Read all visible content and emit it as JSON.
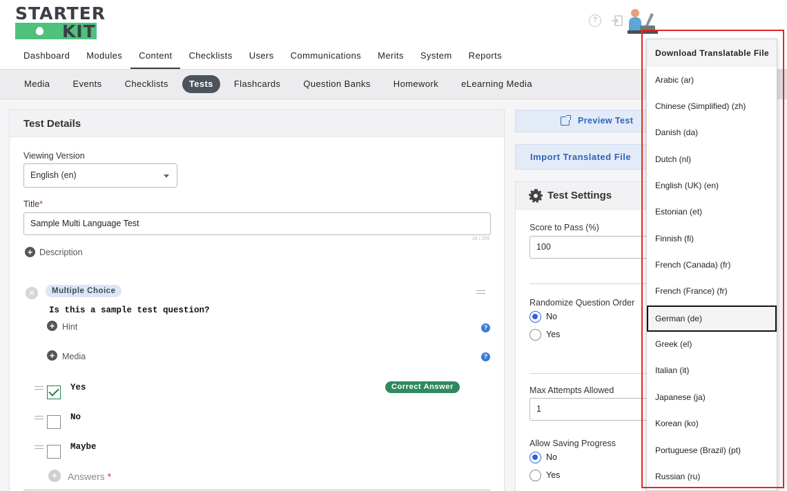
{
  "logo": {
    "line1": "STARTER",
    "line2": "KIT"
  },
  "header": {
    "help_icon": "?"
  },
  "main_nav": [
    "Dashboard",
    "Modules",
    "Content",
    "Checklists",
    "Users",
    "Communications",
    "Merits",
    "System",
    "Reports"
  ],
  "main_nav_active": "Content",
  "sub_nav": [
    "Media",
    "Events",
    "Checklists",
    "Tests",
    "Flashcards",
    "Question Banks",
    "Homework",
    "eLearning Media"
  ],
  "sub_nav_active": "Tests",
  "details": {
    "heading": "Test Details",
    "viewing_version_label": "Viewing Version",
    "viewing_version_value": "English (en)",
    "title_label": "Title",
    "required_mark": "*",
    "title_value": "Sample Multi Language Test",
    "title_counter": "26 / 255",
    "description_label": "Description",
    "question_type": "Multiple Choice",
    "question_text": "Is this a sample test question?",
    "hint_label": "Hint",
    "media_label": "Media",
    "info_glyph": "?",
    "remove_glyph": "✕",
    "plus_glyph": "+",
    "options": [
      {
        "text": "Yes",
        "checked": true
      },
      {
        "text": "No",
        "checked": false
      },
      {
        "text": "Maybe",
        "checked": false
      }
    ],
    "correct_badge": "Correct Answer",
    "answers_label": "Answers"
  },
  "actions": {
    "preview_label": "Preview Test",
    "import_label": "Import Translated File"
  },
  "settings": {
    "heading": "Test Settings",
    "score_label": "Score to Pass (%)",
    "score_value": "100",
    "randomize_label": "Randomize Question Order",
    "randomize_selected": "No",
    "no_label": "No",
    "yes_label": "Yes",
    "max_attempts_label": "Max Attempts Allowed",
    "max_attempts_value": "1",
    "saving_label": "Allow Saving Progress",
    "saving_selected": "No"
  },
  "menu": {
    "items": [
      "Download Translatable File",
      "Arabic (ar)",
      "Chinese (Simplified) (zh)",
      "Danish (da)",
      "Dutch (nl)",
      "English (UK) (en)",
      "Estonian (et)",
      "Finnish (fi)",
      "French (Canada) (fr)",
      "French (France) (fr)",
      "German (de)",
      "Greek (el)",
      "Italian (it)",
      "Japanese (ja)",
      "Korean (ko)",
      "Portuguese (Brazil) (pt)",
      "Russian (ru)"
    ],
    "highlighted": "German (de)"
  },
  "colors": {
    "brand_green": "#4fc17c",
    "accent_blue": "#2f64b8",
    "correct_green": "#2f8a5e",
    "annotation_red": "#e0281e"
  }
}
